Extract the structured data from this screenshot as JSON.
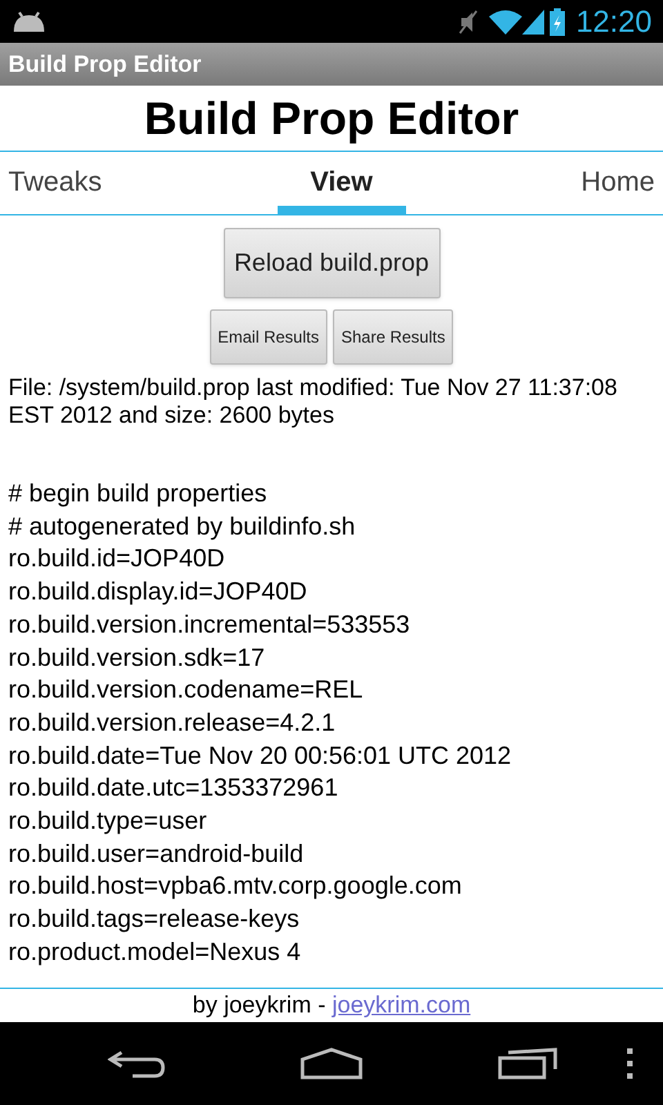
{
  "status_bar": {
    "time": "12:20"
  },
  "action_bar": {
    "title": "Build Prop Editor"
  },
  "header": {
    "title": "Build Prop Editor"
  },
  "tabs": [
    {
      "label": "Tweaks",
      "selected": false
    },
    {
      "label": "View",
      "selected": true
    },
    {
      "label": "Home",
      "selected": false
    }
  ],
  "reload_button": "Reload build.prop",
  "result_buttons": [
    "Email Results",
    "Share Results"
  ],
  "file_info": "File: /system/build.prop last modified: Tue Nov 27 11:37:08 EST 2012 and size: 2600 bytes",
  "lines": [
    "# begin build properties",
    "# autogenerated by buildinfo.sh",
    "ro.build.id=JOP40D",
    "ro.build.display.id=JOP40D",
    "ro.build.version.incremental=533553",
    "ro.build.version.sdk=17",
    "ro.build.version.codename=REL",
    "ro.build.version.release=4.2.1",
    "ro.build.date=Tue Nov 20 00:56:01 UTC 2012",
    "ro.build.date.utc=1353372961",
    "ro.build.type=user",
    "ro.build.user=android-build",
    "ro.build.host=vpba6.mtv.corp.google.com",
    "ro.build.tags=release-keys",
    "ro.product.model=Nexus 4"
  ],
  "footer": {
    "text": "by joeykrim -",
    "link": "joeykrim.com"
  }
}
